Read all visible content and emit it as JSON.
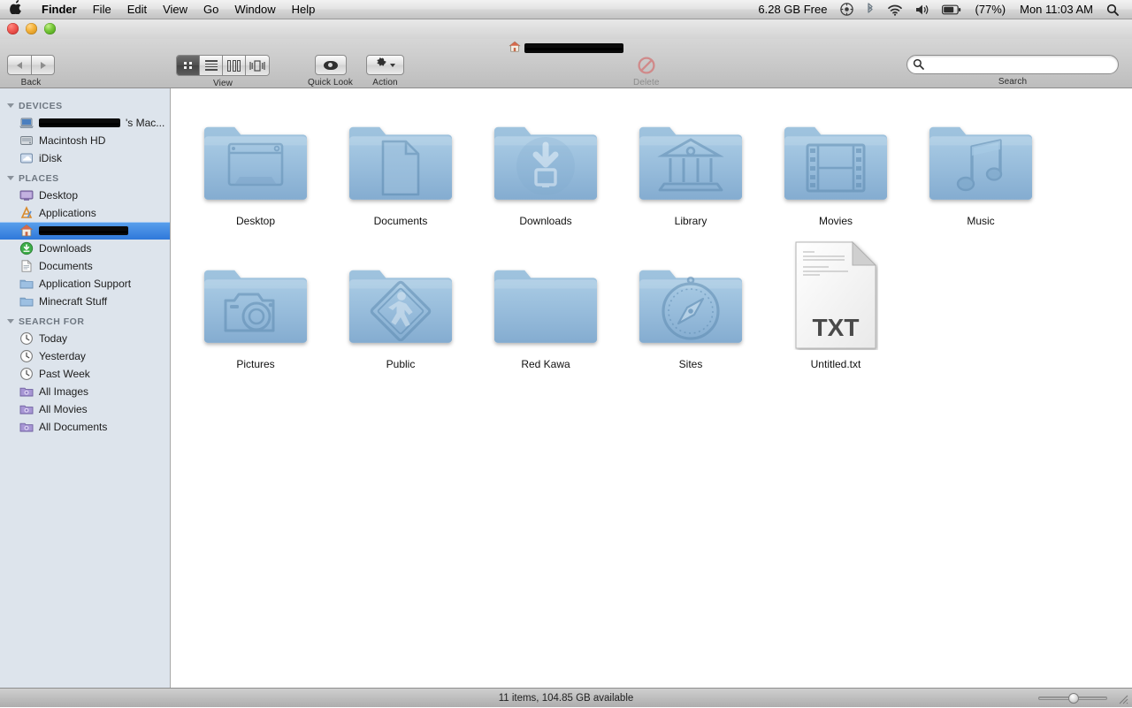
{
  "menubar": {
    "apple_icon": "apple-icon",
    "items": [
      {
        "label": "Finder",
        "bold": true
      },
      {
        "label": "File",
        "bold": false
      },
      {
        "label": "Edit",
        "bold": false
      },
      {
        "label": "View",
        "bold": false
      },
      {
        "label": "Go",
        "bold": false
      },
      {
        "label": "Window",
        "bold": false
      },
      {
        "label": "Help",
        "bold": false
      }
    ],
    "status": {
      "free_space": "6.28 GB Free",
      "battery_percent": "(77%)",
      "clock": "Mon 11:03 AM",
      "icons": [
        "spotlight-gear-icon",
        "bluetooth-icon",
        "wifi-icon",
        "volume-icon",
        "battery-icon",
        "search-icon"
      ]
    }
  },
  "window": {
    "title_redacted": true,
    "title_icon": "home-icon",
    "title_text": ""
  },
  "toolbar": {
    "back_label": "Back",
    "view_label": "View",
    "view_options": [
      "icon-view",
      "list-view",
      "column-view",
      "coverflow-view"
    ],
    "view_selected_index": 0,
    "quicklook_label": "Quick Look",
    "action_label": "Action",
    "delete_label": "Delete",
    "search_label": "Search",
    "search_value": "",
    "search_placeholder": ""
  },
  "sidebar": {
    "sections": [
      {
        "header": "DEVICES",
        "items": [
          {
            "label": "",
            "redacted": true,
            "redact_width": 92,
            "suffix": "'s Mac...",
            "icon": "laptop-icon",
            "selected": false
          },
          {
            "label": "Macintosh HD",
            "redacted": false,
            "icon": "harddisk-icon",
            "selected": false
          },
          {
            "label": "iDisk",
            "redacted": false,
            "icon": "idisk-icon",
            "selected": false
          }
        ]
      },
      {
        "header": "PLACES",
        "items": [
          {
            "label": "Desktop",
            "redacted": false,
            "icon": "desktop-icon",
            "selected": false
          },
          {
            "label": "Applications",
            "redacted": false,
            "icon": "applications-icon",
            "selected": false
          },
          {
            "label": "",
            "redacted": true,
            "redact_width": 101,
            "suffix": "",
            "icon": "home-icon",
            "selected": true
          },
          {
            "label": "Downloads",
            "redacted": false,
            "icon": "downloads-icon",
            "selected": false
          },
          {
            "label": "Documents",
            "redacted": false,
            "icon": "documents-icon",
            "selected": false
          },
          {
            "label": "Application Support",
            "redacted": false,
            "icon": "folder-icon",
            "selected": false
          },
          {
            "label": "Minecraft Stuff",
            "redacted": false,
            "icon": "folder-icon",
            "selected": false
          }
        ]
      },
      {
        "header": "SEARCH FOR",
        "items": [
          {
            "label": "Today",
            "redacted": false,
            "icon": "clock-icon",
            "selected": false
          },
          {
            "label": "Yesterday",
            "redacted": false,
            "icon": "clock-icon",
            "selected": false
          },
          {
            "label": "Past Week",
            "redacted": false,
            "icon": "clock-icon",
            "selected": false
          },
          {
            "label": "All Images",
            "redacted": false,
            "icon": "smart-folder-icon",
            "selected": false
          },
          {
            "label": "All Movies",
            "redacted": false,
            "icon": "smart-folder-icon",
            "selected": false
          },
          {
            "label": "All Documents",
            "redacted": false,
            "icon": "smart-folder-icon",
            "selected": false
          }
        ]
      }
    ]
  },
  "files": [
    {
      "name": "Desktop",
      "kind": "folder",
      "glyph": "desktop-window-glyph"
    },
    {
      "name": "Documents",
      "kind": "folder",
      "glyph": "document-page-glyph"
    },
    {
      "name": "Downloads",
      "kind": "folder",
      "glyph": "download-arrow-glyph"
    },
    {
      "name": "Library",
      "kind": "folder",
      "glyph": "classical-building-glyph"
    },
    {
      "name": "Movies",
      "kind": "folder",
      "glyph": "film-strip-glyph"
    },
    {
      "name": "Music",
      "kind": "folder",
      "glyph": "music-note-glyph"
    },
    {
      "name": "Pictures",
      "kind": "folder",
      "glyph": "camera-glyph"
    },
    {
      "name": "Public",
      "kind": "folder",
      "glyph": "pedestrian-sign-glyph"
    },
    {
      "name": "Red Kawa",
      "kind": "folder",
      "glyph": "plain-glyph"
    },
    {
      "name": "Sites",
      "kind": "folder",
      "glyph": "compass-glyph"
    },
    {
      "name": "Untitled.txt",
      "kind": "text-document",
      "glyph": "txt-document",
      "badge": "TXT"
    }
  ],
  "statusbar": {
    "text": "11 items, 104.85 GB available",
    "zoom_slider_value": 45
  },
  "colors": {
    "selection_blue": "#2f78da",
    "folder_blue": "#8fb5d4",
    "sidebar_bg": "#dde4ec",
    "toolbar_gray": "#c6c6c6"
  }
}
